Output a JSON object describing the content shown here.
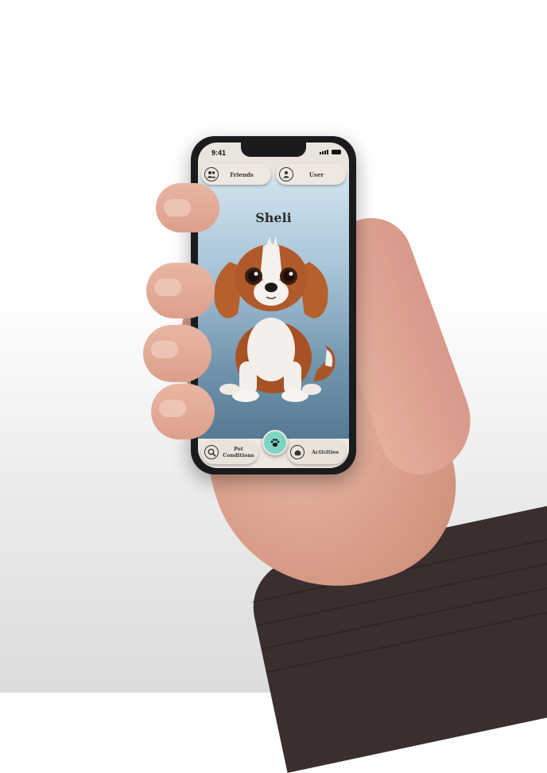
{
  "status": {
    "time": "9:41"
  },
  "header": {
    "friends_label": "Friends",
    "user_label": "User"
  },
  "pet": {
    "name": "Sheli"
  },
  "nav": {
    "pet_conditions_label_line1": "Pet",
    "pet_conditions_label_line2": "Conditions",
    "activities_label": "Activities",
    "center_icon": "paw-icon"
  },
  "icons": {
    "friends": "friends-icon",
    "user": "user-icon",
    "pet_conditions": "search-pet-icon",
    "activities": "dog-icon"
  },
  "colors": {
    "accent": "#7fd3c5",
    "pill": "#eee8e0",
    "sky_top": "#cfe1ec",
    "sky_bottom": "#4b6f89"
  }
}
